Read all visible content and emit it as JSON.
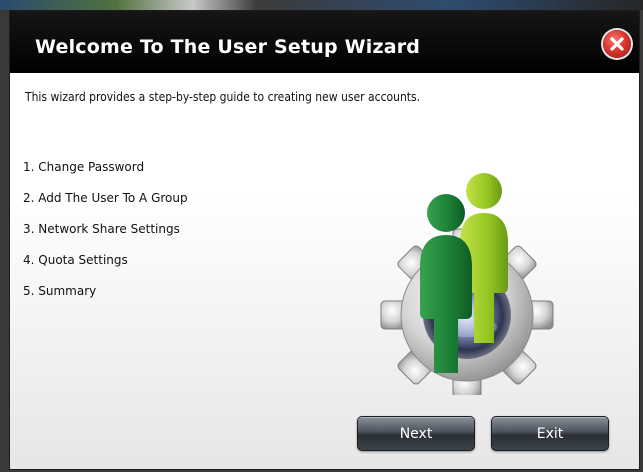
{
  "dialog": {
    "title": "Welcome To The User Setup Wizard",
    "close_icon": "close-icon",
    "intro": "This wizard provides a step-by-step guide to creating new user accounts.",
    "steps": [
      "1. Change Password",
      "2. Add The User To A Group",
      "3. Network Share Settings",
      "4. Quota Settings",
      "5. Summary"
    ],
    "illustration_icon": "users-gear-icon",
    "buttons": {
      "next_label": "Next",
      "exit_label": "Exit"
    }
  },
  "colors": {
    "titlebar": "#000000",
    "close_button": "#d9362f",
    "user_front": "#1e8a3a",
    "user_back": "#9bcb2a",
    "button": "#3d434b"
  }
}
